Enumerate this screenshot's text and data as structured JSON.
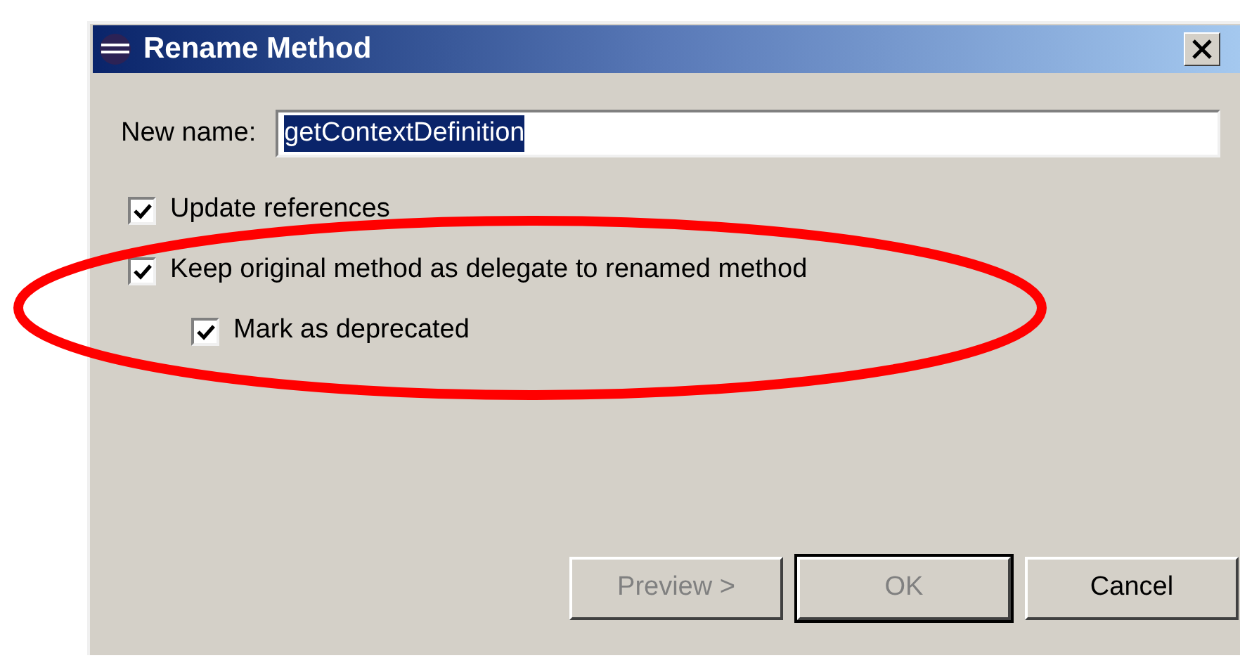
{
  "window": {
    "title": "Rename Method"
  },
  "name_field": {
    "label": "New name:",
    "value": "getContextDefinition"
  },
  "options": [
    {
      "label": "Update references",
      "checked": true
    },
    {
      "label": "Keep original method as delegate to renamed method",
      "checked": true,
      "children": [
        {
          "label": "Mark as deprecated",
          "checked": true
        }
      ]
    }
  ],
  "buttons": [
    {
      "label": "Preview >",
      "disabled": true,
      "default": false
    },
    {
      "label": "OK",
      "disabled": true,
      "default": true
    },
    {
      "label": "Cancel",
      "disabled": false,
      "default": false
    }
  ],
  "annotation": {
    "kind": "ellipse",
    "color": "#ff0000"
  }
}
